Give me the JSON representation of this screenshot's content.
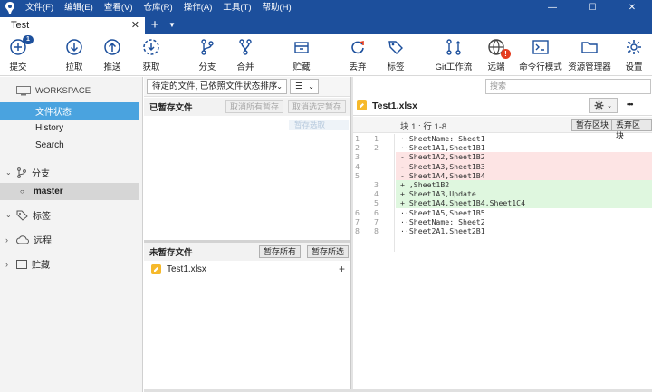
{
  "menu": [
    "文件(F)",
    "编辑(E)",
    "查看(V)",
    "仓库(R)",
    "操作(A)",
    "工具(T)",
    "帮助(H)"
  ],
  "window_controls": {
    "minimize": "—",
    "maximize": "☐",
    "close": "✕"
  },
  "tab": {
    "title": "Test",
    "close": "✕",
    "add": "+",
    "more": "▼"
  },
  "toolbar": [
    {
      "label": "提交",
      "icon": "commit-icon",
      "badge": "1"
    },
    {
      "label": "拉取",
      "icon": "pull-icon"
    },
    {
      "label": "推送",
      "icon": "push-icon"
    },
    {
      "label": "获取",
      "icon": "fetch-icon"
    },
    {
      "label": "分支",
      "icon": "branch-icon"
    },
    {
      "label": "合并",
      "icon": "merge-icon"
    },
    {
      "label": "贮藏",
      "icon": "stash-icon"
    },
    {
      "label": "丢弃",
      "icon": "discard-icon"
    },
    {
      "label": "标签",
      "icon": "tag-icon"
    },
    {
      "label": "Git工作流",
      "icon": "git-flow-icon"
    },
    {
      "label": "远端",
      "icon": "remote-icon",
      "alert": "!"
    },
    {
      "label": "命令行模式",
      "icon": "terminal-icon"
    },
    {
      "label": "资源管理器",
      "icon": "explorer-icon"
    },
    {
      "label": "设置",
      "icon": "settings-icon"
    }
  ],
  "sidebar": {
    "workspace": "WORKSPACE",
    "items": [
      "文件状态",
      "History",
      "Search"
    ],
    "branches": {
      "label": "分支",
      "items": [
        "master"
      ]
    },
    "tags": "标签",
    "remotes": "远程",
    "stashes": "贮藏"
  },
  "filter": {
    "sort": "待定的文件, 已依照文件状态排序",
    "view": "☰"
  },
  "staged": {
    "title": "已暂存文件",
    "unstage_all": "取消所有暂存",
    "unstage_selected": "取消选定暂存",
    "unstage_tip": "暂存选取"
  },
  "unstaged": {
    "title": "未暂存文件",
    "stage_all": "暂存所有",
    "stage_selected": "暂存所选",
    "file": "Test1.xlsx",
    "add": "+"
  },
  "search": {
    "placeholder": "搜索"
  },
  "diff": {
    "file": "Test1.xlsx",
    "more": "•••",
    "hunk": "块 1 : 行 1-8",
    "stage_hunk": "暂存区块",
    "discard_hunk": "丢弃区块",
    "lines": [
      {
        "old": "1",
        "new": "1",
        "type": "ctx",
        "text": "··SheetName: Sheet1"
      },
      {
        "old": "2",
        "new": "2",
        "type": "ctx",
        "text": "··Sheet1A1,Sheet1B1"
      },
      {
        "old": "3",
        "new": "",
        "type": "del",
        "text": "- Sheet1A2,Sheet1B2"
      },
      {
        "old": "4",
        "new": "",
        "type": "del",
        "text": "- Sheet1A3,Sheet1B3"
      },
      {
        "old": "5",
        "new": "",
        "type": "del",
        "text": "- Sheet1A4,Sheet1B4"
      },
      {
        "old": "",
        "new": "3",
        "type": "add",
        "text": "+ ,Sheet1B2"
      },
      {
        "old": "",
        "new": "4",
        "type": "add",
        "text": "+ Sheet1A3,Update"
      },
      {
        "old": "",
        "new": "5",
        "type": "add",
        "text": "+ Sheet1A4,Sheet1B4,Sheet1C4"
      },
      {
        "old": "6",
        "new": "6",
        "type": "ctx",
        "text": "··Sheet1A5,Sheet1B5"
      },
      {
        "old": "7",
        "new": "7",
        "type": "ctx",
        "text": "··SheetName: Sheet2"
      },
      {
        "old": "8",
        "new": "8",
        "type": "ctx",
        "text": "··Sheet2A1,Sheet2B1"
      }
    ]
  },
  "colors": {
    "accent": "#1c4f9c",
    "selected": "#4aa3df",
    "file": "#f6b92b"
  }
}
